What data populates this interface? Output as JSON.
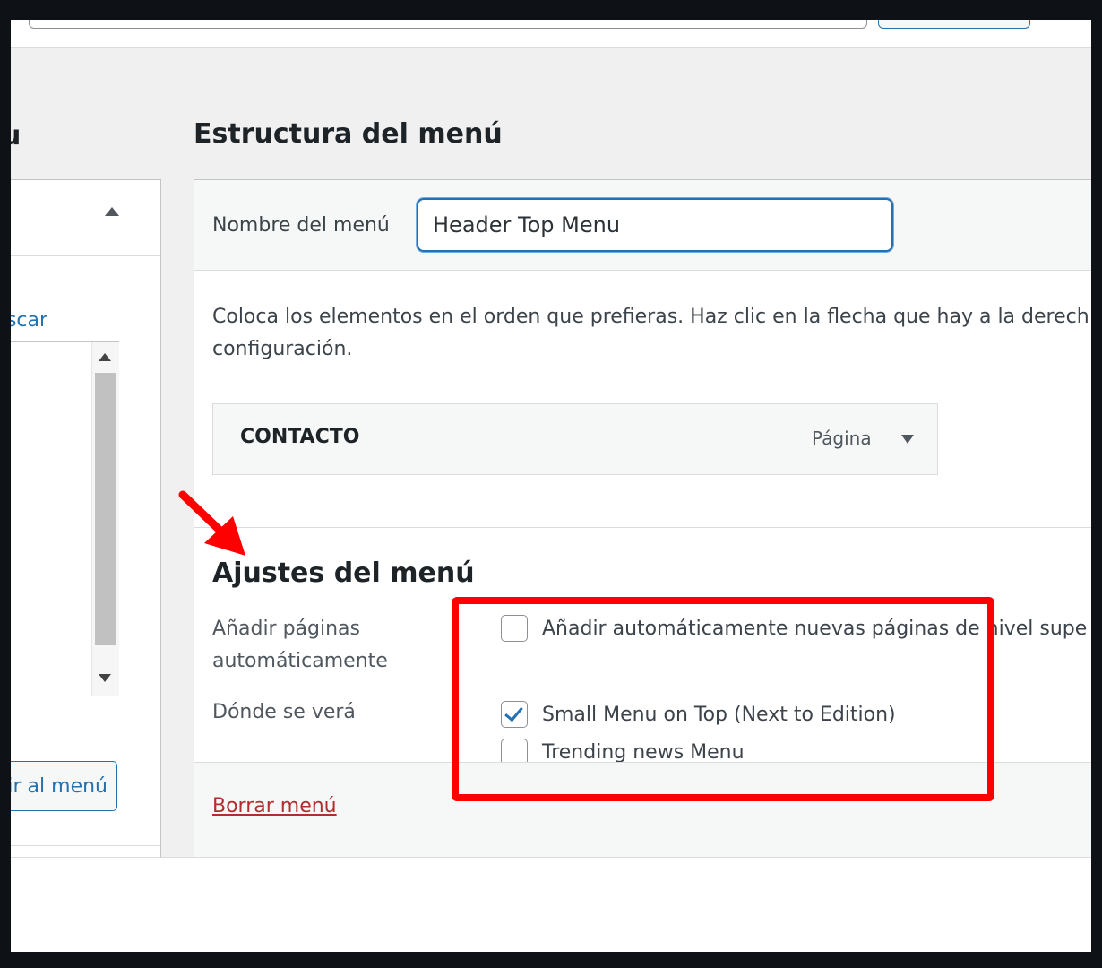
{
  "left_panel": {
    "heading": "u",
    "search_link": "uscar",
    "add_button": "dir al menú"
  },
  "menu_structure": {
    "heading": "Estructura del menú",
    "name_label": "Nombre del menú",
    "name_value": "Header Top Menu",
    "instructions_line1": "Coloca los elementos en el orden que prefieras. Haz clic en la flecha que hay a la derech",
    "instructions_line2": "configuración.",
    "items": [
      {
        "title": "CONTACTO",
        "type": "Página"
      }
    ]
  },
  "menu_settings": {
    "title": "Ajustes del menú",
    "auto_add_label": "Añadir páginas automáticamente",
    "auto_add_option": "Añadir automáticamente nuevas páginas de nivel supe",
    "auto_add_checked": false,
    "location_label": "Dónde se verá",
    "locations": [
      {
        "label": "Small Menu on Top (Next to Edition)",
        "checked": true
      },
      {
        "label": "Trending news Menu",
        "checked": false
      }
    ]
  },
  "footer": {
    "delete_link": "Borrar menú"
  },
  "colors": {
    "accent": "#2271b1",
    "danger": "#b32d2e",
    "annotation": "#ff0000"
  }
}
